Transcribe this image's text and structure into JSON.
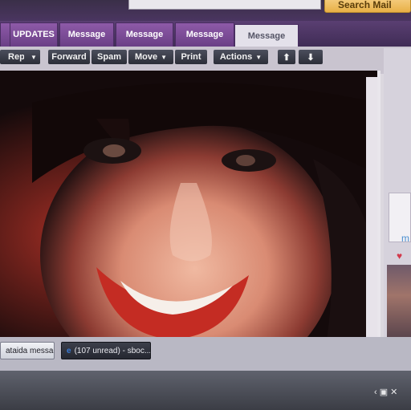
{
  "header": {
    "search_button": "Search Mail"
  },
  "tabs": [
    {
      "label": "UPDATES"
    },
    {
      "label": "Message"
    },
    {
      "label": "Message"
    },
    {
      "label": "Message"
    },
    {
      "label": "Message"
    }
  ],
  "toolbar": {
    "reply": "Reply",
    "forward": "Forward",
    "spam": "Spam",
    "move": "Move",
    "print": "Print",
    "actions": "Actions",
    "up": "⬆",
    "down": "⬇"
  },
  "sidebar": {
    "m_label": "m"
  },
  "taskbar": {
    "item1": "ataida message...",
    "item2": "(107 unread) - sboc..."
  },
  "colors": {
    "accent": "#6a3f86",
    "search": "#e8b046"
  },
  "icons": {
    "heart": "heart-icon",
    "ie": "ie-icon"
  }
}
